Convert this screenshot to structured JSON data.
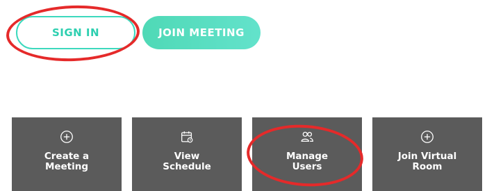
{
  "auth_buttons": {
    "sign_in_label": "SIGN IN",
    "join_meeting_label": "JOIN MEETING"
  },
  "tiles": [
    {
      "label": "Create a\nMeeting",
      "icon": "plus-circle-icon"
    },
    {
      "label": "View\nSchedule",
      "icon": "calendar-icon"
    },
    {
      "label": "Manage\nUsers",
      "icon": "users-icon"
    },
    {
      "label": "Join Virtual\nRoom",
      "icon": "plus-circle-icon"
    }
  ],
  "colors": {
    "accent_teal": "#3cd9bd",
    "tile_bg": "#5b5b5b",
    "annotation_red": "#e52a2a"
  }
}
